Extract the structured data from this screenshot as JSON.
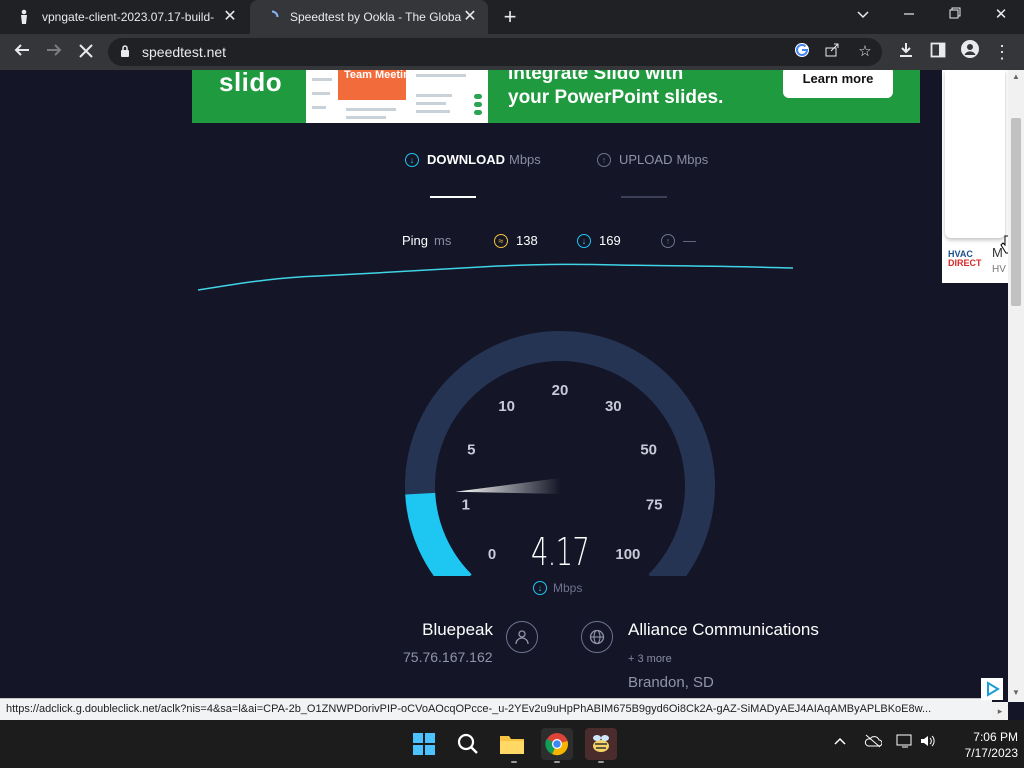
{
  "browser": {
    "tabs": [
      {
        "title": "vpngate-client-2023.07.17-build-",
        "active": false
      },
      {
        "title": "Speedtest by Ookla - The Global",
        "active": true
      }
    ],
    "url": "speedtest.net",
    "status_url": "https://adclick.g.doubleclick.net/aclk?nis=4&sa=l&ai=CPA-2b_O1ZNWPDorivPIP-oCVoAOcqOPcce-_u-2YEv2u9uHpPhABIM675B9gyd6Oi8Ck2A-gAZ-SiMADyAEJ4AIAqAMByAPLBKoE8w..."
  },
  "ad_banner": {
    "brand": "slido",
    "mock_title": "Team Meeting",
    "headline_line1": "Integrate Slido with",
    "headline_line2": "your PowerPoint slides.",
    "cta": "Learn more"
  },
  "side_ad": {
    "brand": "HVAC DIRECT",
    "text1": "M",
    "text2": "HV"
  },
  "speedtest": {
    "download_label": "DOWNLOAD",
    "upload_label": "UPLOAD",
    "unit": "Mbps",
    "ping_label": "Ping",
    "ping_unit": "ms",
    "ping_idle": "138",
    "ping_download": "169",
    "ping_upload": "—",
    "current_speed": "4.17",
    "gauge_labels": [
      "0",
      "1",
      "5",
      "10",
      "20",
      "30",
      "50",
      "75",
      "100"
    ],
    "gauge_fraction": 0.155,
    "isp_name": "Bluepeak",
    "ip": "75.76.167.162",
    "server_name": "Alliance Communications",
    "more_servers": "+ 3 more",
    "location": "Brandon, SD"
  },
  "taskbar": {
    "time": "7:06 PM",
    "date": "7/17/2023"
  },
  "colors": {
    "accent": "#1ec6f2",
    "background": "#141526",
    "track": "#243452"
  }
}
